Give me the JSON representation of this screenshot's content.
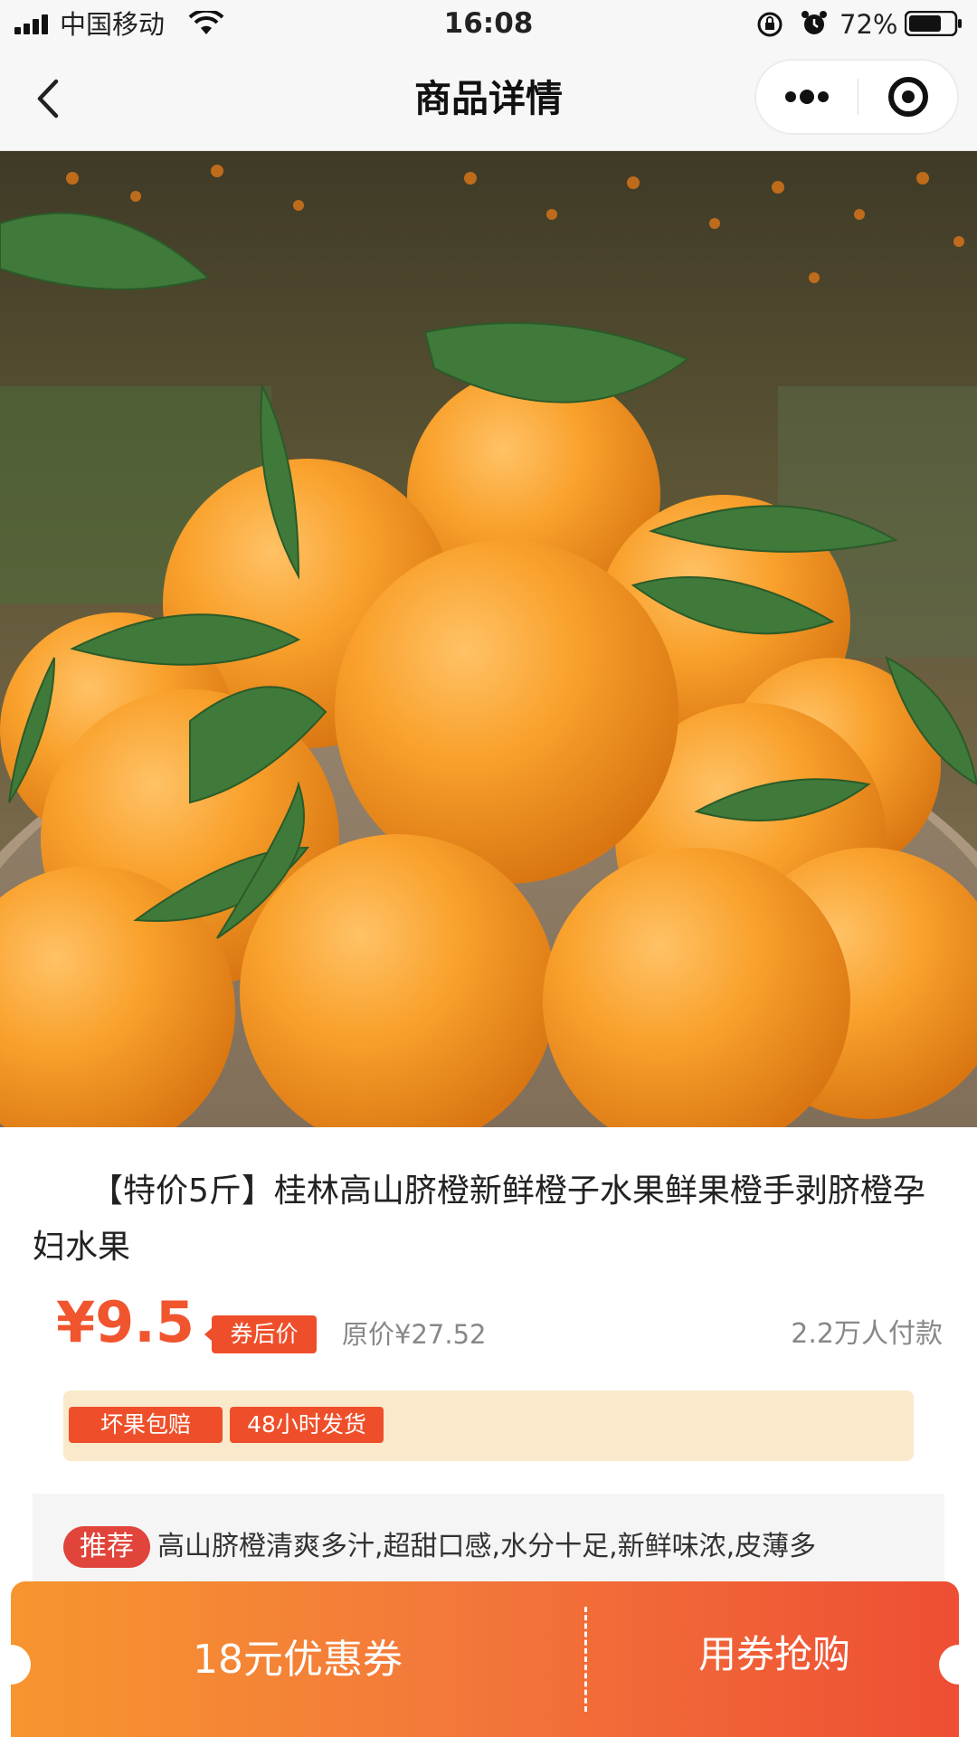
{
  "status_bar": {
    "carrier": "中国移动",
    "time": "16:08",
    "battery_percent": "72%",
    "battery_level": 0.72
  },
  "nav": {
    "title": "商品详情"
  },
  "product": {
    "title": "【特价5斤】桂林高山脐橙新鲜橙子水果鲜果橙手剥脐橙孕妇水果",
    "price": "¥9.5",
    "price_tag": "券后价",
    "original_price": "原价¥27.52",
    "sales": "2.2万人付款",
    "services": [
      "坏果包赔",
      "48小时发货"
    ],
    "recommend_badge": "推荐",
    "recommend_text": "高山脐橙清爽多汁,超甜口感,水分十足,新鲜味浓,皮薄多"
  },
  "coupon_bar": {
    "coupon_label": "18元优惠券",
    "buy_label": "用券抢购"
  },
  "colors": {
    "accent": "#ee4f2a",
    "price": "#f0552e",
    "service_bg": "#faeacb",
    "gradient_start": "#f7952f",
    "gradient_end": "#ee4e34"
  }
}
